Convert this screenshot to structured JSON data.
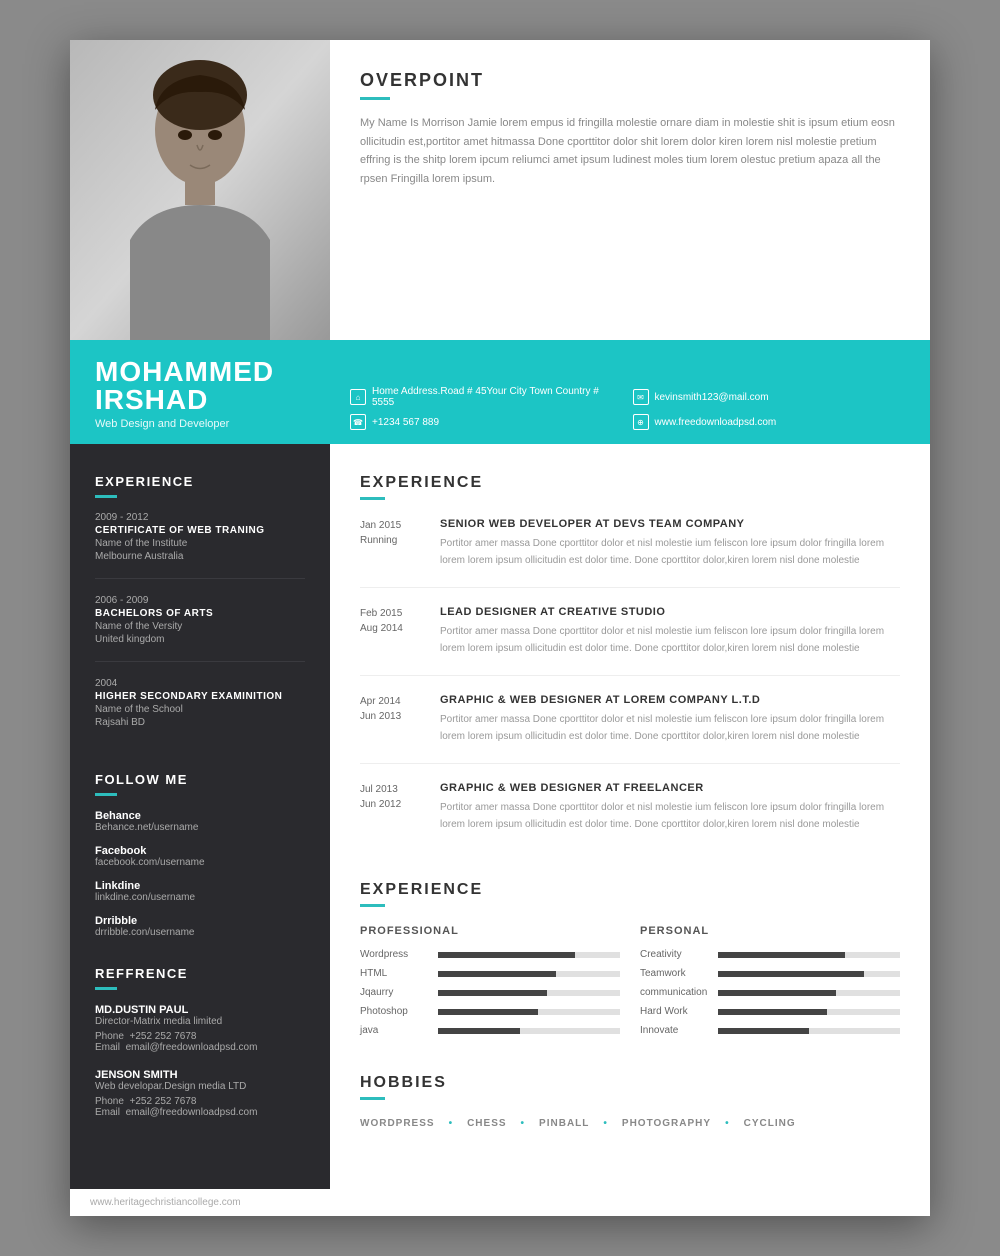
{
  "resume": {
    "photo_alt": "Mohammed Irshad photo",
    "intro": {
      "title": "OVERPOINT",
      "text": "My Name Is Morrison Jamie lorem empus id fringilla molestie ornare diam in molestie shit is ipsum etium eosn ollicitudin est,portitor amet hitmassa Done cporttitor dolor shit lorem dolor kiren lorem nisl molestie pretium effring is the shitp lorem ipcum reliumci amet ipsum ludinest moles tium lorem olestuc pretium apaza all the rpsen Fringilla lorem ipsum."
    },
    "name": "MOHAMMED IRSHAD",
    "subtitle": "Web Design and Developer",
    "contact": [
      {
        "icon": "📍",
        "text": "Home Address.Road # 45Your City Town Country # 5555"
      },
      {
        "icon": "📧",
        "text": "kevinsmith123@mail.com"
      },
      {
        "icon": "📞",
        "text": "+1234 567 889"
      },
      {
        "icon": "🌐",
        "text": "www.freedownloadpsd.com"
      }
    ],
    "sidebar": {
      "experience_heading": "EXPERIENCE",
      "education": [
        {
          "date": "2009 - 2012",
          "degree": "CERTIFICATE OF WEB TRANING",
          "institute": "Name of the Institute",
          "location": "Melbourne Australia"
        },
        {
          "date": "2006 - 2009",
          "degree": "BACHELORS OF ARTS",
          "institute": "Name of the Versity",
          "location": "United kingdom"
        },
        {
          "date": "2004",
          "degree": "HIGHER SECONDARY EXAMINITION",
          "institute": "Name of the School",
          "location": "Rajsahi BD"
        }
      ],
      "follow_heading": "FOLLOW ME",
      "social": [
        {
          "name": "Behance",
          "url": "Behance.net/username"
        },
        {
          "name": "Facebook",
          "url": "facebook.com/username"
        },
        {
          "name": "Linkdine",
          "url": "linkdine.con/username"
        },
        {
          "name": "Drribble",
          "url": "drribble.con/username"
        }
      ],
      "reference_heading": "REFFRENCE",
      "references": [
        {
          "name": "MD.DUSTIN PAUL",
          "role": "Director-Matrix media limited",
          "phone": "+252 252 7678",
          "email": "email@freedownloadpsd.com"
        },
        {
          "name": "JENSON SMITH",
          "role": "Web developar.Design media LTD",
          "phone": "+252 252 7678",
          "email": "email@freedownloadpsd.com"
        }
      ]
    },
    "main": {
      "experience_heading": "EXPERIENCE",
      "jobs": [
        {
          "date_start": "Jan 2015",
          "date_end": "Running",
          "title": "SENIOR WEB DEVELOPER AT DEVS TEAM COMPANY",
          "desc": "Portitor amer massa Done cporttitor dolor et nisl molestie ium feliscon lore ipsum dolor fringilla lorem lorem lorem ipsum ollicitudin est dolor time. Done cporttitor dolor,kiren lorem nisl done molestie"
        },
        {
          "date_start": "Feb 2015",
          "date_end": "Aug 2014",
          "title": "LEAD DESIGNER AT CREATIVE STUDIO",
          "desc": "Portitor amer massa Done cporttitor dolor et nisl molestie ium feliscon lore ipsum dolor fringilla lorem lorem lorem ipsum ollicitudin est dolor time. Done cporttitor dolor,kiren lorem nisl done molestie"
        },
        {
          "date_start": "Apr 2014",
          "date_end": "Jun 2013",
          "title": "GRAPHIC & WEB DESIGNER AT LOREM COMPANY L.T.D",
          "desc": "Portitor amer massa Done cporttitor dolor et nisl molestie ium feliscon lore ipsum dolor fringilla lorem lorem lorem ipsum ollicitudin est dolor time. Done cporttitor dolor,kiren lorem nisl done molestie"
        },
        {
          "date_start": "Jul 2013",
          "date_end": "Jun 2012",
          "title": "GRAPHIC & WEB DESIGNER AT FREELANCER",
          "desc": "Portitor amer massa Done cporttitor dolor et nisl molestie ium feliscon lore ipsum dolor fringilla lorem lorem lorem ipsum ollicitudin est dolor time. Done cporttitor dolor,kiren lorem nisl done molestie"
        }
      ],
      "skills_heading": "EXPERIENCE",
      "skills_pro_label": "PROFESSIONAL",
      "skills_per_label": "PERSONAL",
      "skills_professional": [
        {
          "name": "Wordpress",
          "pct": 75
        },
        {
          "name": "HTML",
          "pct": 65
        },
        {
          "name": "Jqaurry",
          "pct": 60
        },
        {
          "name": "Photoshop",
          "pct": 55
        },
        {
          "name": "java",
          "pct": 45
        }
      ],
      "skills_personal": [
        {
          "name": "Creativity",
          "pct": 70
        },
        {
          "name": "Teamwork",
          "pct": 80
        },
        {
          "name": "communication",
          "pct": 65
        },
        {
          "name": "Hard Work",
          "pct": 60
        },
        {
          "name": "Innovate",
          "pct": 50
        }
      ],
      "hobbies_heading": "HOBBIES",
      "hobbies": [
        "WORDPRESS",
        "CHESS",
        "PINBALL",
        "PHOTOGRAPHY",
        "CYCLING"
      ]
    }
  },
  "footer": {
    "url": "www.heritagechristiancollege.com"
  }
}
